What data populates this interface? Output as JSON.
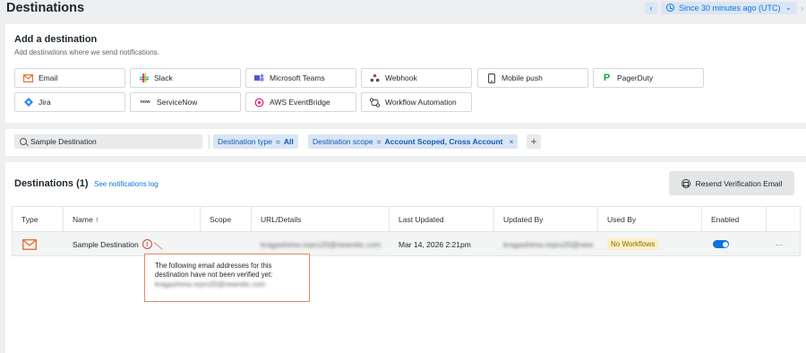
{
  "header": {
    "title": "Destinations",
    "time_label": "Since 30 minutes ago (UTC)",
    "prev_symbol": "‹",
    "next_symbol": "›",
    "caret": "⌄"
  },
  "add_destination": {
    "title": "Add a destination",
    "subtitle": "Add destinations where we send notifications.",
    "options": [
      {
        "label": "Email",
        "icon": "email-icon"
      },
      {
        "label": "Slack",
        "icon": "slack-icon"
      },
      {
        "label": "Microsoft Teams",
        "icon": "teams-icon"
      },
      {
        "label": "Webhook",
        "icon": "webhook-icon"
      },
      {
        "label": "Mobile push",
        "icon": "mobile-icon"
      },
      {
        "label": "PagerDuty",
        "icon": "pagerduty-icon"
      },
      {
        "label": "Jira",
        "icon": "jira-icon"
      },
      {
        "label": "ServiceNow",
        "icon": "servicenow-icon",
        "icon_text": "now"
      },
      {
        "label": "AWS EventBridge",
        "icon": "eventbridge-icon"
      },
      {
        "label": "Workflow Automation",
        "icon": "workflow-icon"
      }
    ]
  },
  "filters": {
    "search_value": "Sample Destination",
    "type_chip": {
      "key": "Destination type",
      "op": "=",
      "value": "All"
    },
    "scope_chip": {
      "key": "Destination scope",
      "op": "=",
      "value": "Account Scoped, Cross Account",
      "remove": "×"
    },
    "add_symbol": "+"
  },
  "list": {
    "title": "Destinations (1)",
    "log_link": "See notifications log",
    "resend_label": "Resend Verification Email",
    "columns": [
      "Type",
      "Name ↑",
      "Scope",
      "URL/Details",
      "Last Updated",
      "Updated By",
      "Used By",
      "Enabled"
    ],
    "rows": [
      {
        "name": "Sample Destination",
        "warning": "!",
        "url": "kragashima-nrpro20@newrelic.com",
        "last_updated": "Mar 14, 2026 2:21pm",
        "updated_by": "kragashima-nrpro20@newrelic.com",
        "used_by": "No Workflows",
        "enabled": true,
        "more": "···"
      }
    ]
  },
  "tooltip": {
    "text": "The following email addresses for this destination have not been verified yet:",
    "email": "kragashima-nrpro20@newrelic.com"
  },
  "colors": {
    "accent": "#0c74df",
    "email_icon": "#e8703a",
    "warning": "#d1453b",
    "pagerduty": "#06ac38"
  }
}
